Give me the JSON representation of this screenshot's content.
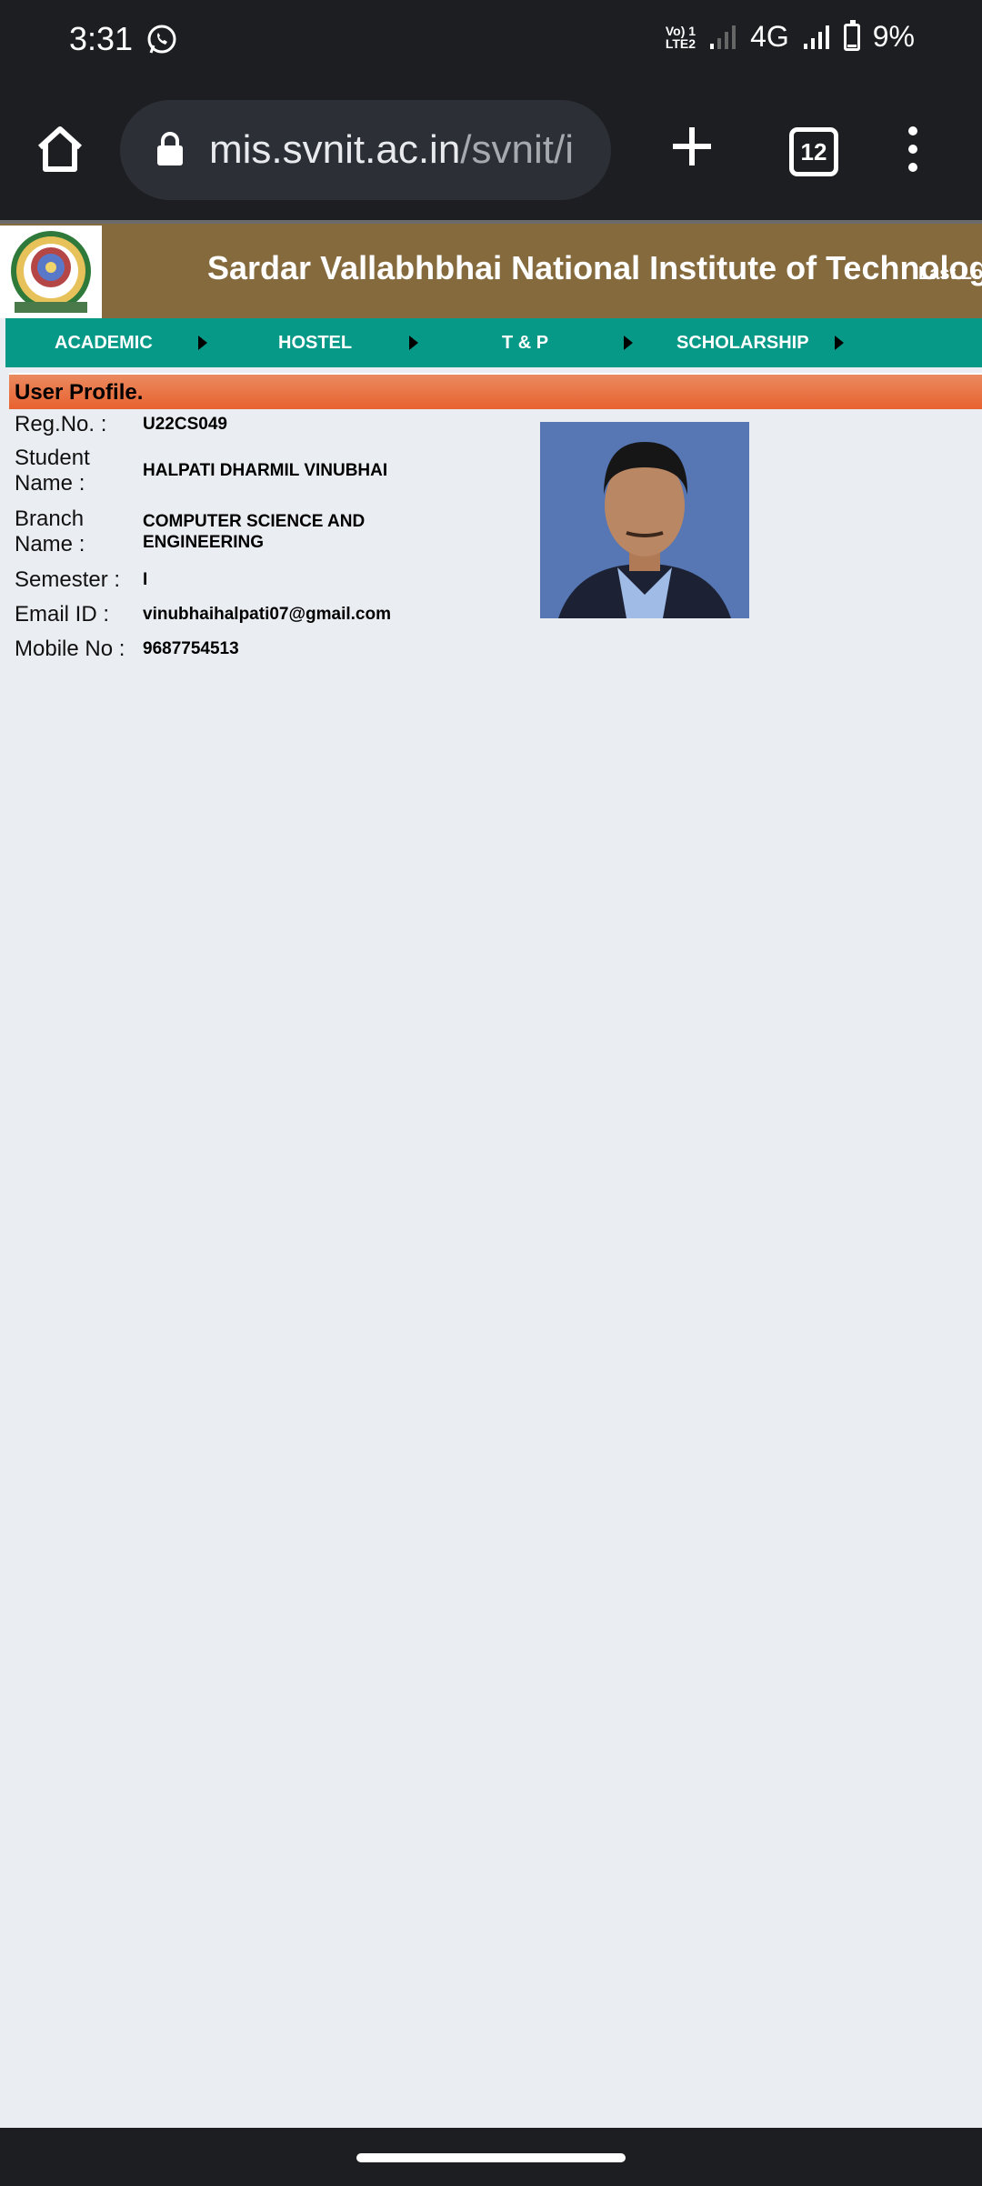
{
  "status_bar": {
    "time": "3:31",
    "network_volte": "Vo) 1",
    "network_lte": "LTE2",
    "network_type": "4G",
    "battery": "9%"
  },
  "browser": {
    "url_main": "mis.svnit.ac.in",
    "url_path": "/svnit/i",
    "tab_count": "12"
  },
  "header": {
    "title": "Sardar Vallabhbhai National Institute of Technology",
    "last_login": "Last Log"
  },
  "nav": {
    "items": [
      {
        "label": "ACADEMIC"
      },
      {
        "label": "HOSTEL"
      },
      {
        "label": "T & P"
      },
      {
        "label": "SCHOLARSHIP"
      }
    ]
  },
  "profile": {
    "heading": "User Profile.",
    "fields": [
      {
        "label": "Reg.No. :",
        "value": "U22CS049"
      },
      {
        "label": "Student Name :",
        "value": "HALPATI DHARMIL VINUBHAI"
      },
      {
        "label": "Branch Name :",
        "value": "COMPUTER SCIENCE AND ENGINEERING"
      },
      {
        "label": "Semester :",
        "value": "I"
      },
      {
        "label": "Email ID :",
        "value": "vinubhaihalpati07@gmail.com"
      },
      {
        "label": "Mobile No :",
        "value": "9687754513"
      }
    ]
  }
}
